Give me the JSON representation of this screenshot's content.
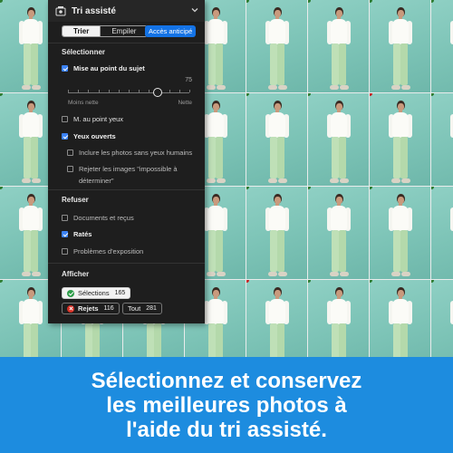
{
  "colors": {
    "panel_bg": "#1e1e1e",
    "accent_blue": "#1473e6",
    "checkbox_blue": "#3b82f6",
    "caption_bg": "#1d8cdf",
    "photo_backdrop": "#7cc3b6",
    "pick_flag": "#2e7d32",
    "reject_flag": "#c62828"
  },
  "panel": {
    "icon": "assisted-sort-icon",
    "title": "Tri assisté",
    "collapse_icon": "chevron-down-icon",
    "segmented": {
      "sort_label": "Trier",
      "stack_label": "Empiler",
      "selected": "Trier"
    },
    "early_access_label": "Accès anticipé",
    "select_heading": "Sélectionner",
    "subject_focus": {
      "label": "Mise au point du sujet",
      "checked": true
    },
    "slider": {
      "value": "75",
      "level_percent": 75,
      "min_label": "Moins nette",
      "max_label": "Nette"
    },
    "eye_focus": {
      "label": "M. au point yeux",
      "checked": false
    },
    "eyes_open": {
      "label": "Yeux ouverts",
      "checked": true
    },
    "include_non_human": {
      "label": "Inclure les photos sans yeux humains",
      "checked": false
    },
    "reject_undetermined": {
      "label_line1": "Rejeter les images \"impossible à",
      "label_line2": "déterminer\"",
      "checked": false
    },
    "reject_heading": "Refuser",
    "documents": {
      "label": "Documents et reçus",
      "checked": false
    },
    "missed": {
      "label": "Ratés",
      "checked": true
    },
    "exposure": {
      "label": "Problèmes d'exposition",
      "checked": false
    },
    "show_heading": "Afficher",
    "show": {
      "selections": {
        "label": "Sélections",
        "count": "165",
        "icon": "check-circle-icon"
      },
      "rejects": {
        "label": "Rejets",
        "count": "116",
        "icon": "x-circle-icon"
      },
      "all": {
        "label": "Tout",
        "count": "281"
      }
    }
  },
  "caption": {
    "line1": "Sélectionnez et conservez",
    "line2": "les meilleures photos à",
    "line3": "l'aide du tri assisté."
  }
}
